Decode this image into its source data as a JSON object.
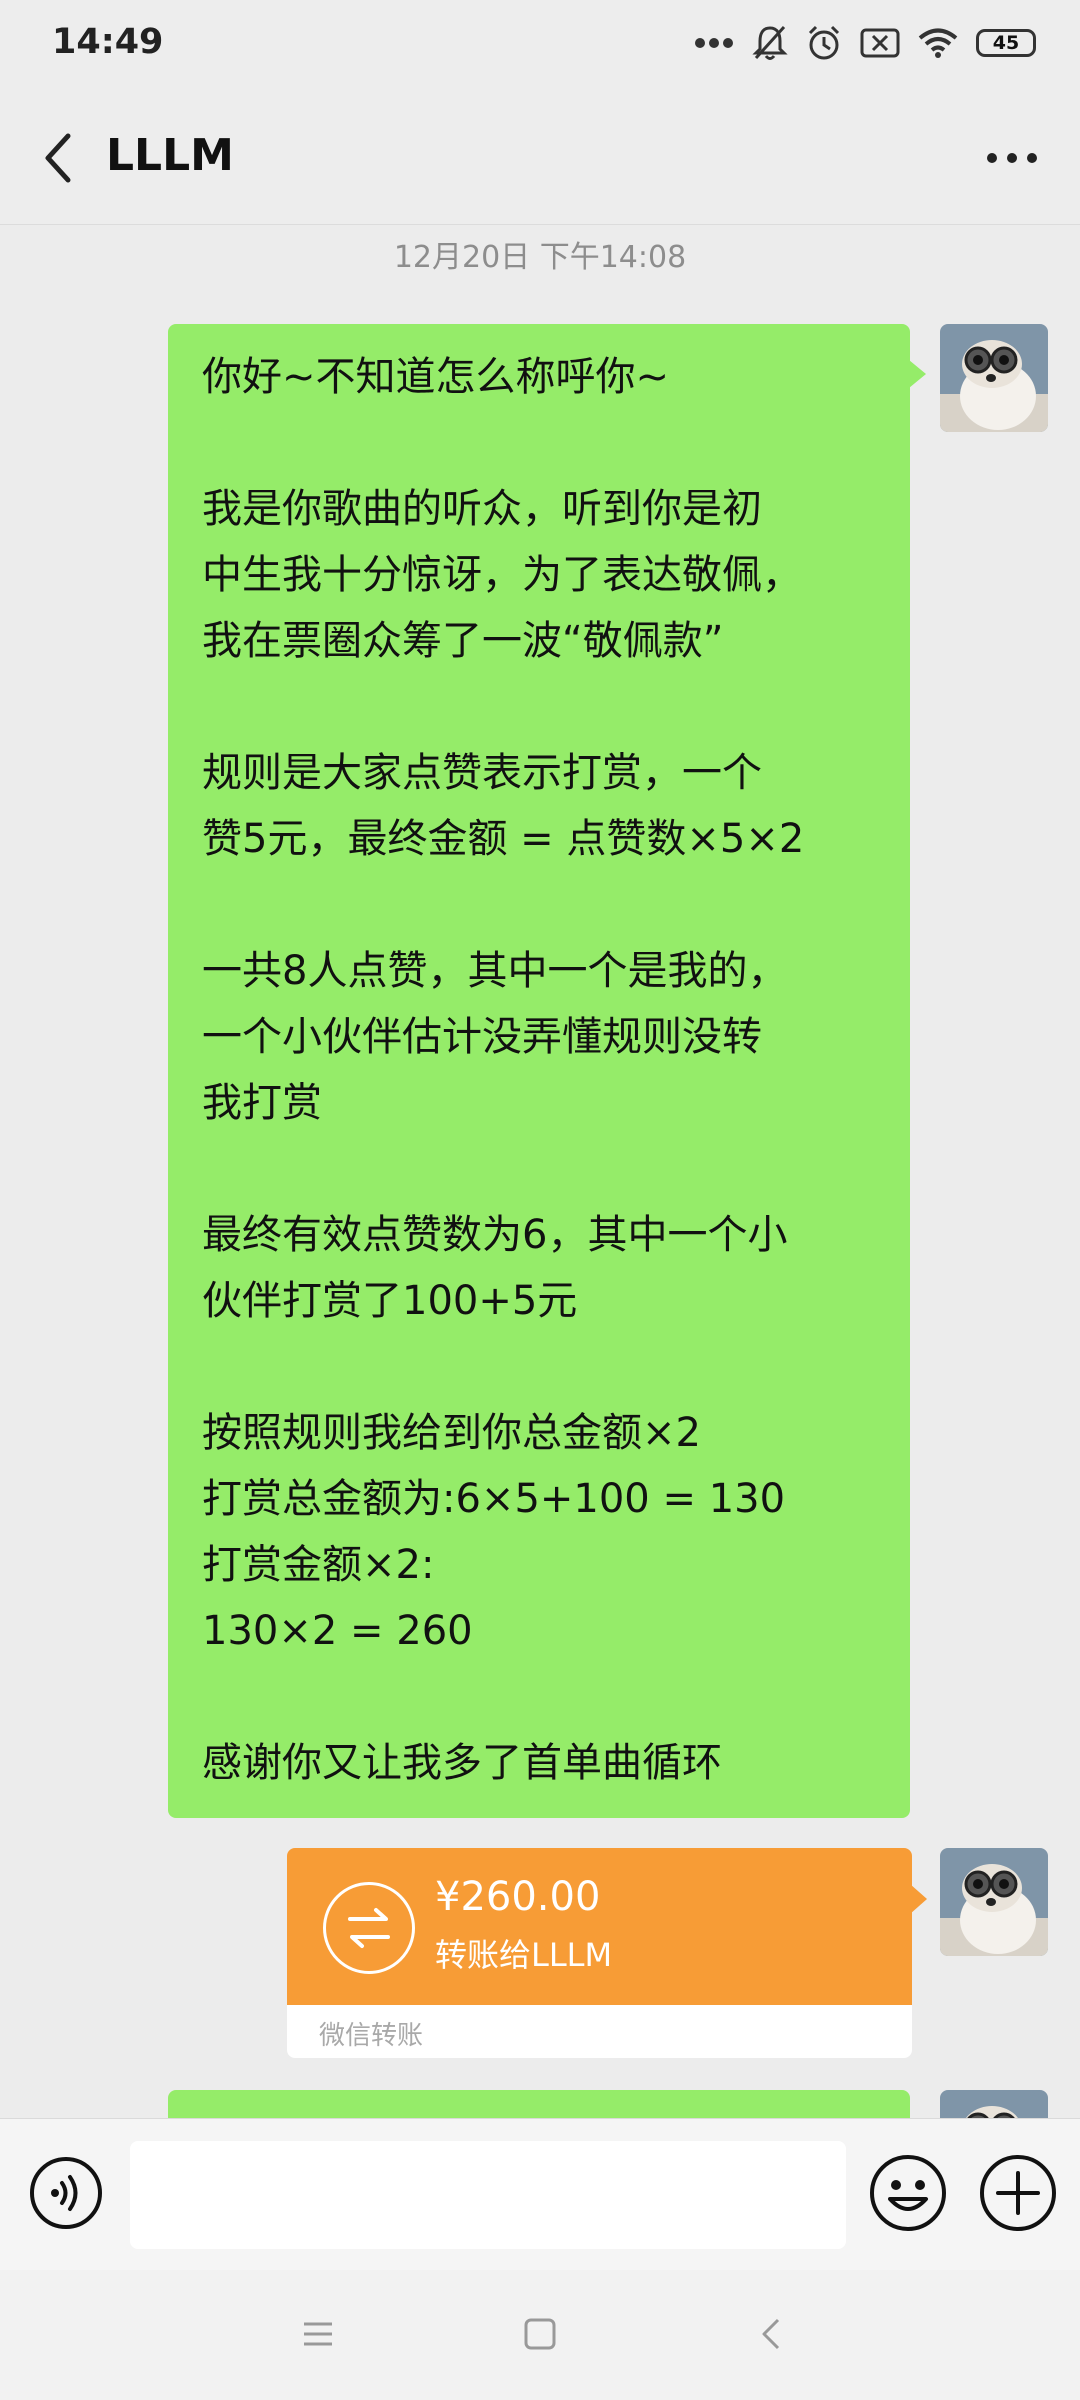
{
  "status_bar": {
    "time": "14:49",
    "battery": "45",
    "icons": [
      "more-dots-icon",
      "mute-bell-icon",
      "alarm-icon",
      "sim-x-icon",
      "wifi-icon",
      "battery-icon"
    ]
  },
  "header": {
    "title": "LLLM",
    "back_icon": "back-chevron-icon",
    "more_icon": "more-icon"
  },
  "chat": {
    "timestamp": "12月20日 下午14:08",
    "message_lines": [
      "你好~不知道怎么称呼你~",
      "",
      "我是你歌曲的听众，听到你是初",
      "中生我十分惊讶，为了表达敬佩，",
      "我在票圈众筹了一波“敬佩款”",
      "",
      "规则是大家点赞表示打赏，一个",
      "赞5元，最终金额 = 点赞数×5×2",
      "",
      "一共8人点赞，其中一个是我的，",
      "一个小伙伴估计没弄懂规则没转",
      "我打赏",
      "",
      "最终有效点赞数为6，其中一个小",
      "伙伴打赏了100+5元",
      "",
      "按照规则我给到你总金额×2",
      "打赏总金额为:6×5+100 = 130",
      "打赏金额×2:",
      "130×2 = 260",
      "",
      "感谢你又让我多了首单曲循环"
    ],
    "transfer": {
      "amount": "¥260.00",
      "description": "转账给LLLM",
      "label": "微信转账",
      "icon": "transfer-arrows-icon"
    }
  },
  "input_bar": {
    "voice_icon": "voice-icon",
    "text_value": "",
    "emoji_icon": "emoji-icon",
    "plus_icon": "plus-icon"
  },
  "nav_bar": {
    "icons": [
      "menu-icon",
      "home-square-icon",
      "back-triangle-icon"
    ]
  },
  "colors": {
    "bubble_green": "#95ec69",
    "transfer_orange": "#f79c36",
    "background": "#ececec"
  }
}
